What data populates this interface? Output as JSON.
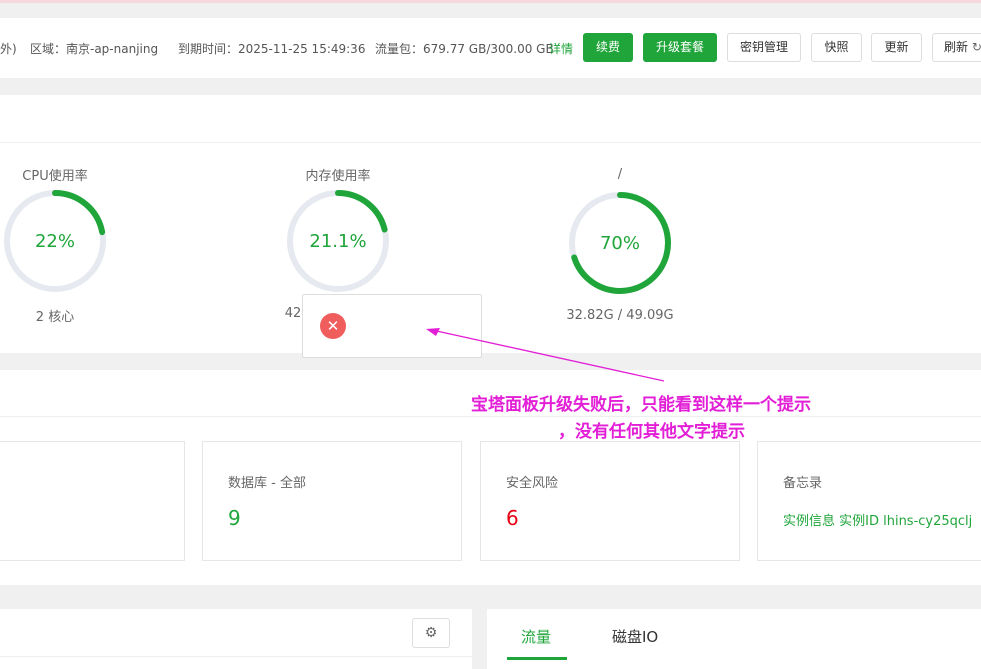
{
  "header": {
    "clip_left": "外)",
    "region_label": "区域：南京-ap-nanjing",
    "expire_label": "到期时间：2025-11-25 15:49:36",
    "traffic_label": "流量包：679.77 GB/300.00 GB",
    "detail_link": "详情",
    "buttons": {
      "renew": "续费",
      "upgrade": "升级套餐",
      "key_manage": "密钥管理",
      "snapshot": "快照",
      "update": "更新",
      "refresh": "刷新"
    }
  },
  "gauges": [
    {
      "title": "CPU使用率",
      "value_text": "22%",
      "percent": 22,
      "sub": "2 核心"
    },
    {
      "title": "内存使用率",
      "value_text": "21.1%",
      "percent": 21.1,
      "sub": "42"
    },
    {
      "title": "/",
      "value_text": "70%",
      "percent": 70,
      "sub": "32.82G / 49.09G"
    }
  ],
  "cards": {
    "database": {
      "title": "数据库 - 全部",
      "value": "9"
    },
    "security": {
      "title": "安全风险",
      "value": "6"
    },
    "memo": {
      "title": "备忘录",
      "content": "实例信息 实例ID lhins-cy25qclj"
    }
  },
  "tabs": {
    "traffic": "流量",
    "disk_io": "磁盘IO"
  },
  "annotation": {
    "line1": "宝塔面板升级失败后，只能看到这样一个提示",
    "line2": "，没有任何其他文字提示"
  },
  "colors": {
    "accent": "#20a53a",
    "danger": "#ef5d5d",
    "annotation": "#e21fd6",
    "risk": "#e60012"
  }
}
